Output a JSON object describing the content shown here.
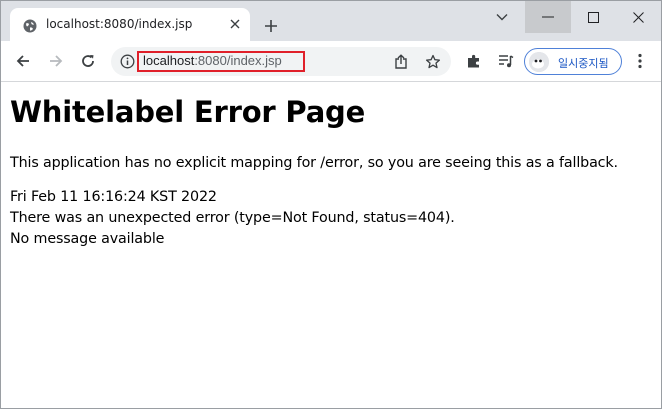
{
  "browser": {
    "tab": {
      "title": "localhost:8080/index.jsp"
    },
    "address_bar": {
      "url_host": "localhost",
      "url_rest": ":8080/index.jsp"
    },
    "profile": {
      "label": "일시중지됨"
    },
    "colors": {
      "tabstrip": "#dee1e6",
      "highlight_box": "#e0202a",
      "profile_border": "#4f81d8",
      "profile_text": "#1a56c4"
    },
    "icons": [
      "globe-icon",
      "close-icon",
      "plus-icon",
      "chevron-down-icon",
      "minimize-icon",
      "maximize-icon",
      "window-close-icon",
      "back-arrow-icon",
      "forward-arrow-icon",
      "reload-icon",
      "info-icon",
      "share-icon",
      "star-icon",
      "puzzle-icon",
      "media-queue-icon",
      "kebab-menu-icon"
    ]
  },
  "page": {
    "title": "Whitelabel Error Page",
    "description": "This application has no explicit mapping for /error, so you are seeing this as a fallback.",
    "timestamp": "Fri Feb 11 16:16:24 KST 2022",
    "error_line": "There was an unexpected error (type=Not Found, status=404).",
    "message": "No message available"
  }
}
